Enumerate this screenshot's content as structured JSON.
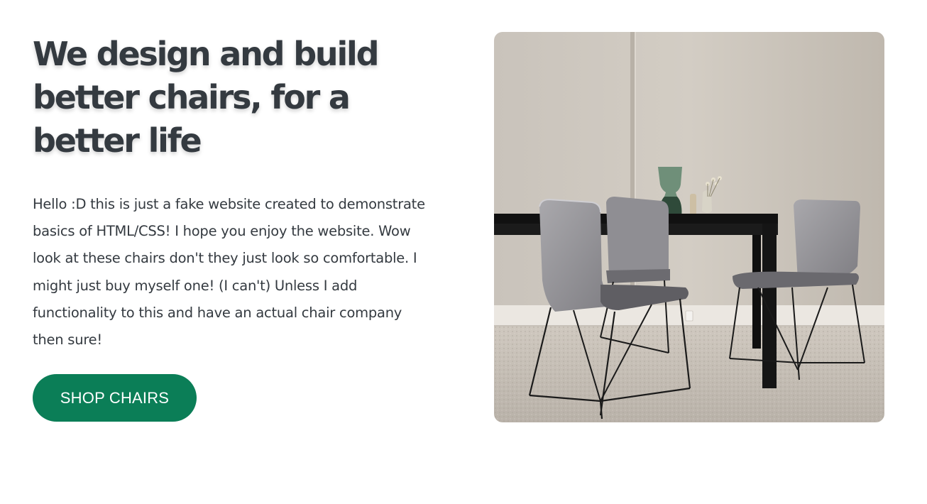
{
  "hero": {
    "headline": "We design and build better chairs, for a better life",
    "description": "Hello :D this is just a fake website created to demonstrate basics of HTML/CSS! I hope you enjoy the website. Wow look at these chairs don't they just look so comfortable. I might just buy myself one! (I can't) Unless I add functionality to this and have an actual chair company then sure!",
    "cta_label": "SHOP CHAIRS"
  },
  "colors": {
    "heading_text": "#343a40",
    "body_text": "#343a40",
    "cta_background": "#0b7e57",
    "cta_text": "#ffffff",
    "page_background": "#ffffff"
  }
}
